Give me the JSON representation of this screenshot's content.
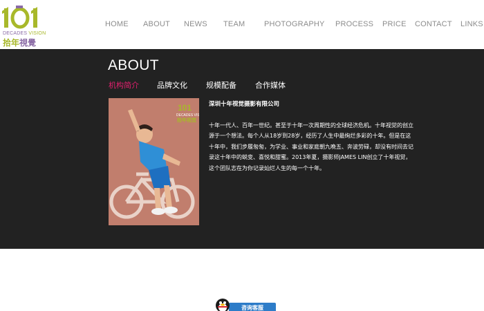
{
  "brand": {
    "logo_number": "101",
    "logo_en_left": "DECADES",
    "logo_en_right": "VISION",
    "logo_cn_left": "拾年",
    "logo_cn_right": "視覺",
    "primary_color": "#a8b82a",
    "secondary_color": "#8a6aa5"
  },
  "nav": {
    "items": [
      "HOME",
      "ABOUT",
      "NEWS",
      "TEAM",
      "PHOTOGRAPHY",
      "PROCESS",
      "PRICE",
      "CONTACT",
      "LINKS"
    ]
  },
  "about": {
    "title": "ABOUT",
    "tabs": [
      {
        "label": "机构简介",
        "active": true
      },
      {
        "label": "品牌文化",
        "active": false
      },
      {
        "label": "规模配备",
        "active": false
      },
      {
        "label": "合作媒体",
        "active": false
      }
    ],
    "company_name": "深圳十年视觉摄影有限公司",
    "description": "十年一代人、百年一世纪。甚至于十年一次周期性的全球经济危机。十年视觉的创立源于一个想法。每个人从18岁到28岁，经历了人生中最绚烂多彩的十年。但是在这十年中，我们步履匆匆，为学业、事业和家庭朝九晚五、奔波劳碌，却没有时间去记录这十年中的蜕变、喜悦和甜蜜。2013年夏，摄影师JAMES LIN创立了十年视觉，这个团队志在为你记录灿烂人生的每一个十年。",
    "photo_icon": "child-bicycle-photo",
    "accent_color": "#e2206e"
  },
  "footer": {
    "qq_button_label": "咨询客服",
    "qq_icon": "qq-penguin-icon"
  }
}
